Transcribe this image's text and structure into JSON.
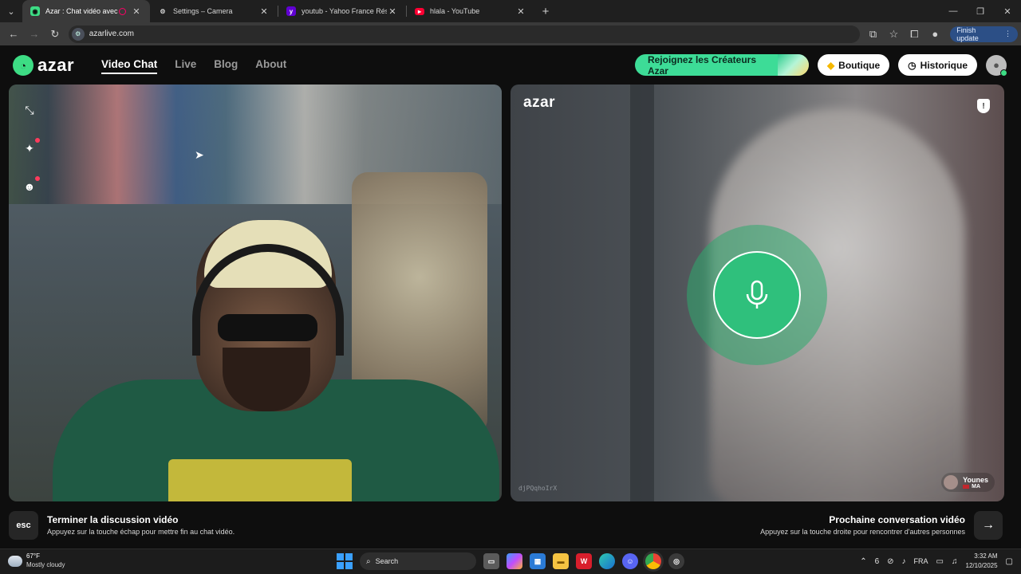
{
  "browser": {
    "tabs": [
      {
        "title": "Azar : Chat vidéo avec de nouvelles personnes",
        "favicon": "azar-icon",
        "active": true
      },
      {
        "title": "Settings – Camera",
        "favicon": "gear-icon",
        "active": false
      },
      {
        "title": "youtub - Yahoo France Résultats de la recherche",
        "favicon": "yahoo-icon",
        "active": false
      },
      {
        "title": "hlala - YouTube",
        "favicon": "youtube-icon",
        "active": false
      }
    ],
    "url": "azarlive.com",
    "update_label": "Finish update"
  },
  "header": {
    "logo_text": "azar",
    "nav": [
      {
        "label": "Video Chat",
        "active": true
      },
      {
        "label": "Live",
        "active": false
      },
      {
        "label": "Blog",
        "active": false
      },
      {
        "label": "About",
        "active": false
      }
    ],
    "creators_label": "Rejoignez les Créateurs Azar",
    "shop_label": "Boutique",
    "history_label": "Historique"
  },
  "right_panel": {
    "logo_text": "azar",
    "session_code": "djPQqhoIrX",
    "peer_name": "Younes",
    "peer_country": "MA"
  },
  "hints": {
    "esc_key": "esc",
    "end_title": "Terminer la discussion vidéo",
    "end_sub": "Appuyez sur la touche échap pour mettre fin au chat vidéo.",
    "next_title": "Prochaine conversation vidéo",
    "next_sub": "Appuyez sur la touche droite pour rencontrer d'autres personnes"
  },
  "taskbar": {
    "temperature": "67°F",
    "weather": "Mostly cloudy",
    "search_placeholder": "Search",
    "language": "FRA",
    "time": "3:32 AM",
    "date": "12/10/2025"
  },
  "colors": {
    "accent_green": "#3ddc97",
    "mic_green": "#2fc07c"
  }
}
